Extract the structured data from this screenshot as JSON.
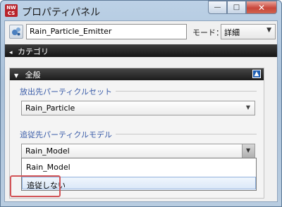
{
  "window": {
    "title": "プロパティパネル",
    "app_icon_top": "NW",
    "app_icon_bottom": "CS",
    "minimize_glyph": "—",
    "maximize_glyph": "□",
    "close_glyph": "✕"
  },
  "object": {
    "icon": "particle-emitter-icon",
    "name": "Rain_Particle_Emitter"
  },
  "mode": {
    "label": "モード：",
    "value": "詳細"
  },
  "category": {
    "label": "カテゴリ"
  },
  "section": {
    "title": "全般",
    "groups": [
      {
        "label": "放出先パーティクルセット",
        "value": "Rain_Particle"
      },
      {
        "label": "追従先パーティクルモデル",
        "value": "Rain_Model",
        "options": [
          "Rain_Model",
          "追従しない"
        ],
        "hovered_option": "追従しない"
      }
    ]
  },
  "colors": {
    "group_label": "#3a5ca8",
    "highlight": "#d25457",
    "header_bg": "#1c1c1c"
  }
}
